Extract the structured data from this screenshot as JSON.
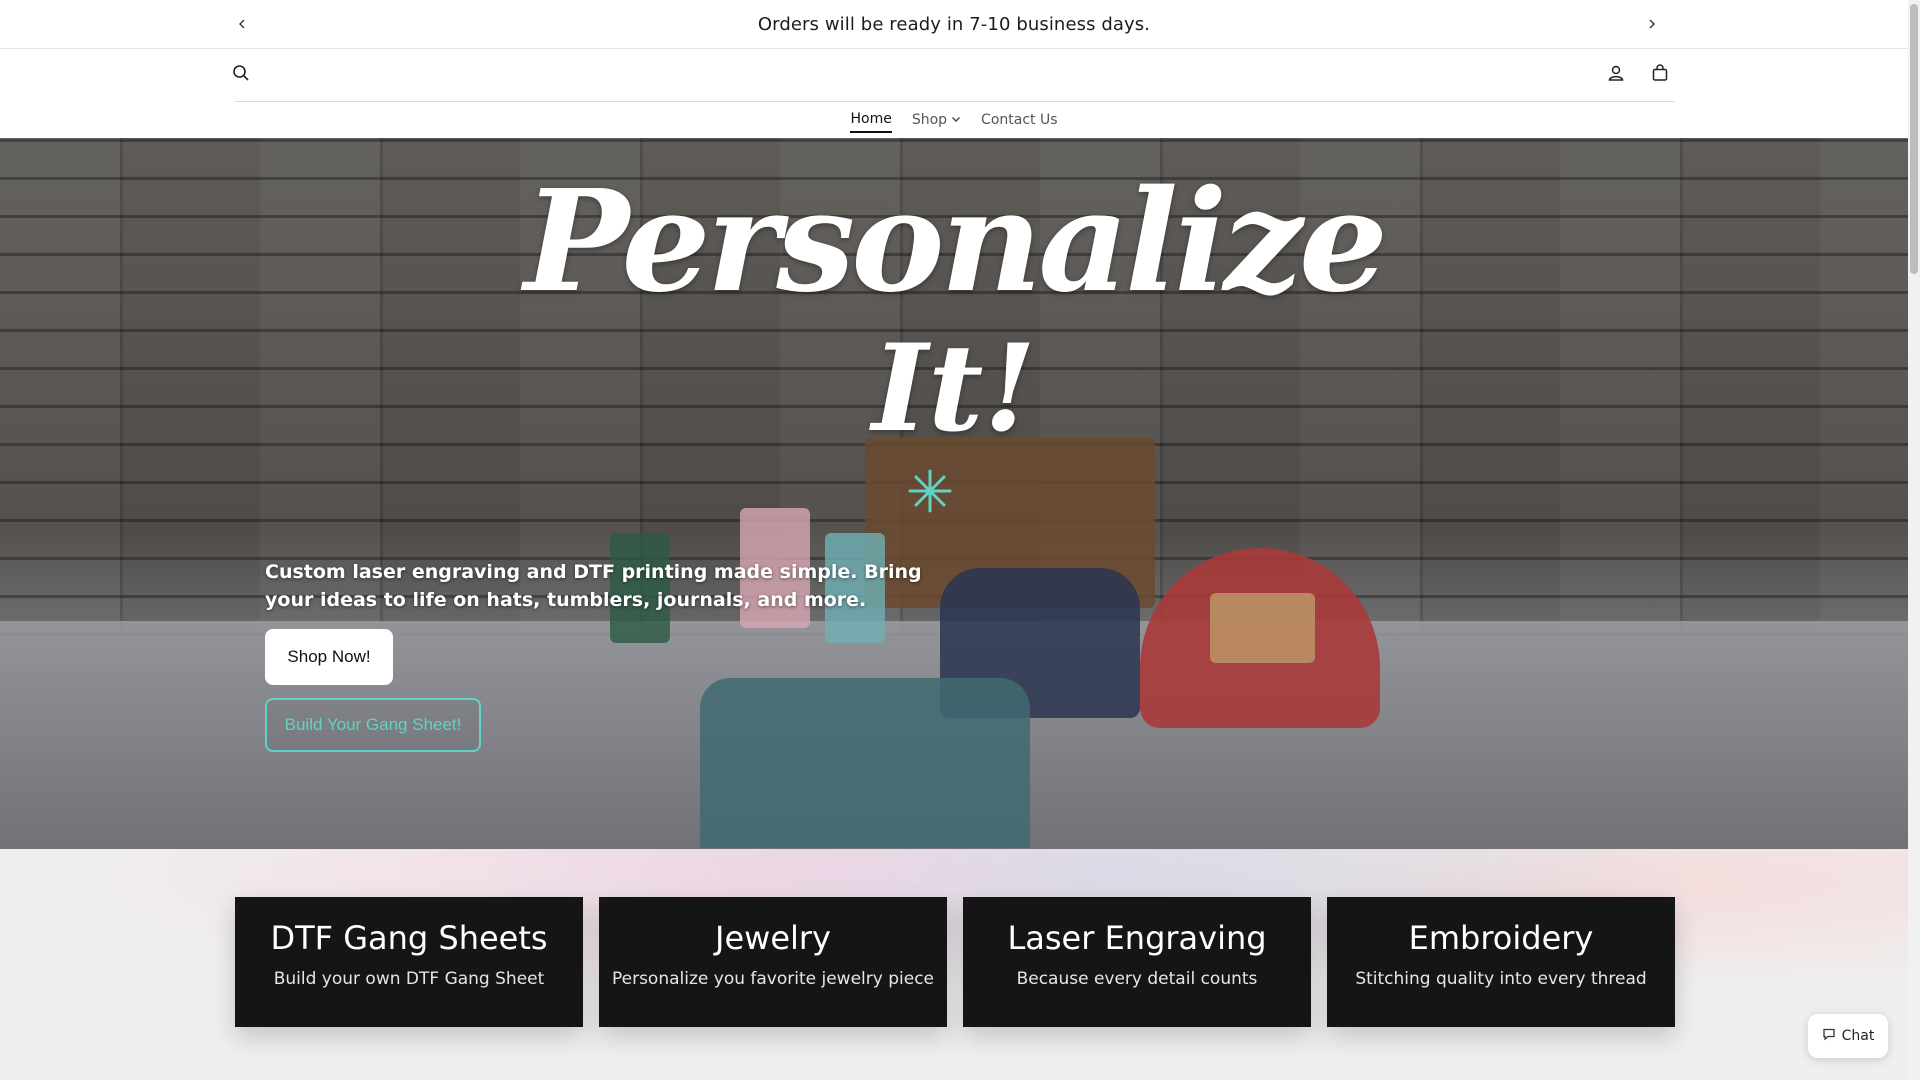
{
  "announcement": {
    "message": "Orders will be ready in 7-10 business days.",
    "prev_icon": "chevron-left-icon",
    "next_icon": "chevron-right-icon"
  },
  "header": {
    "search_icon": "search-icon",
    "account_icon": "user-icon",
    "cart_icon": "shopping-bag-icon"
  },
  "nav": {
    "items": [
      {
        "label": "Home",
        "active": true
      },
      {
        "label": "Shop",
        "has_dropdown": true
      },
      {
        "label": "Contact Us"
      }
    ]
  },
  "hero": {
    "headline": "Personalize",
    "subheadline": "It!",
    "description": "Custom laser engraving and DTF printing made simple. Bring your ideas to life on hats, tumblers, journals, and more.",
    "primary_button": "Shop Now!",
    "secondary_button": "Build Your Gang Sheet!",
    "accent_color": "#5fd3c6"
  },
  "collections": [
    {
      "title": "DTF Gang Sheets",
      "subtitle": "Build your own DTF Gang Sheet"
    },
    {
      "title": "Jewelry",
      "subtitle": "Personalize you favorite jewelry piece"
    },
    {
      "title": "Laser Engraving",
      "subtitle": "Because every detail counts"
    },
    {
      "title": "Embroidery",
      "subtitle": "Stitching quality into every thread"
    }
  ],
  "chat": {
    "label": "Chat",
    "icon": "chat-bubble-icon"
  }
}
